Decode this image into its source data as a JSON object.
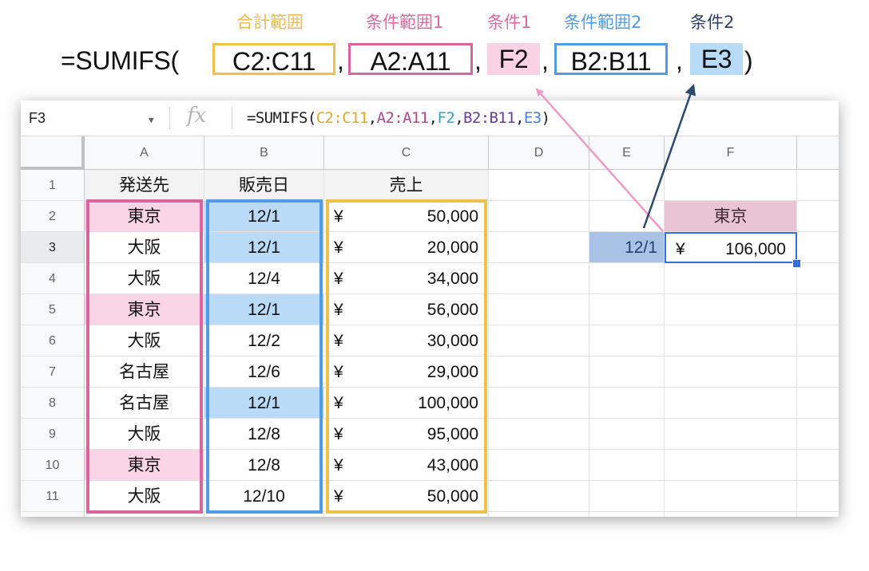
{
  "annotations": {
    "sum_range_label": "合計範囲",
    "criteria_range1_label": "条件範囲1",
    "criteria1_label": "条件1",
    "criteria_range2_label": "条件範囲2",
    "criteria2_label": "条件2",
    "label_colors": {
      "sum": "#f0b94a",
      "cr1": "#e0689e",
      "c1": "#e0689e",
      "cr2": "#4e9be8",
      "c2": "#2d3f6a"
    }
  },
  "formula_display": {
    "prefix": "=SUMIFS(",
    "sum_range": "C2:C11",
    "comma": ",",
    "criteria_range1": "A2:A11",
    "criteria1": "F2",
    "criteria_range2": "B2:B11",
    "criteria2": "E3",
    "suffix": ")"
  },
  "formula_bar": {
    "name_box": "F3",
    "fx_icon": "fx-icon",
    "formula_prefix": "=SUMIFS(",
    "arg1": "C2:C11",
    "arg2": "A2:A11",
    "arg3": "F2",
    "arg4": "B2:B11",
    "arg5": "E3",
    "sep": ",",
    "suffix": ")"
  },
  "columns": [
    "A",
    "B",
    "C",
    "D",
    "E",
    "F"
  ],
  "row_numbers": [
    "1",
    "2",
    "3",
    "4",
    "5",
    "6",
    "7",
    "8",
    "9",
    "10",
    "11"
  ],
  "headers": {
    "a": "発送先",
    "b": "販売日",
    "c": "売上"
  },
  "rows": [
    {
      "a": "東京",
      "b": "12/1",
      "yen": "¥",
      "c": "50,000"
    },
    {
      "a": "大阪",
      "b": "12/1",
      "yen": "¥",
      "c": "20,000"
    },
    {
      "a": "大阪",
      "b": "12/4",
      "yen": "¥",
      "c": "34,000"
    },
    {
      "a": "東京",
      "b": "12/1",
      "yen": "¥",
      "c": "56,000"
    },
    {
      "a": "大阪",
      "b": "12/2",
      "yen": "¥",
      "c": "30,000"
    },
    {
      "a": "名古屋",
      "b": "12/6",
      "yen": "¥",
      "c": "29,000"
    },
    {
      "a": "名古屋",
      "b": "12/1",
      "yen": "¥",
      "c": "100,000"
    },
    {
      "a": "大阪",
      "b": "12/8",
      "yen": "¥",
      "c": "95,000"
    },
    {
      "a": "東京",
      "b": "12/8",
      "yen": "¥",
      "c": "43,000"
    },
    {
      "a": "大阪",
      "b": "12/10",
      "yen": "¥",
      "c": "50,000"
    }
  ],
  "criteria_cells": {
    "f2": "東京",
    "e3": "12/1",
    "f3_yen": "¥",
    "f3": "106,000"
  },
  "colors": {
    "pink_highlight": "#f9d4e6",
    "blue_highlight": "#b9dbf7",
    "range_pink": "#d9649e",
    "range_blue": "#4e9be8",
    "range_yellow": "#f0c04a",
    "arrow_pink": "#f29ac7",
    "arrow_navy": "#2b4a6f",
    "selection": "#2f6fe0"
  }
}
